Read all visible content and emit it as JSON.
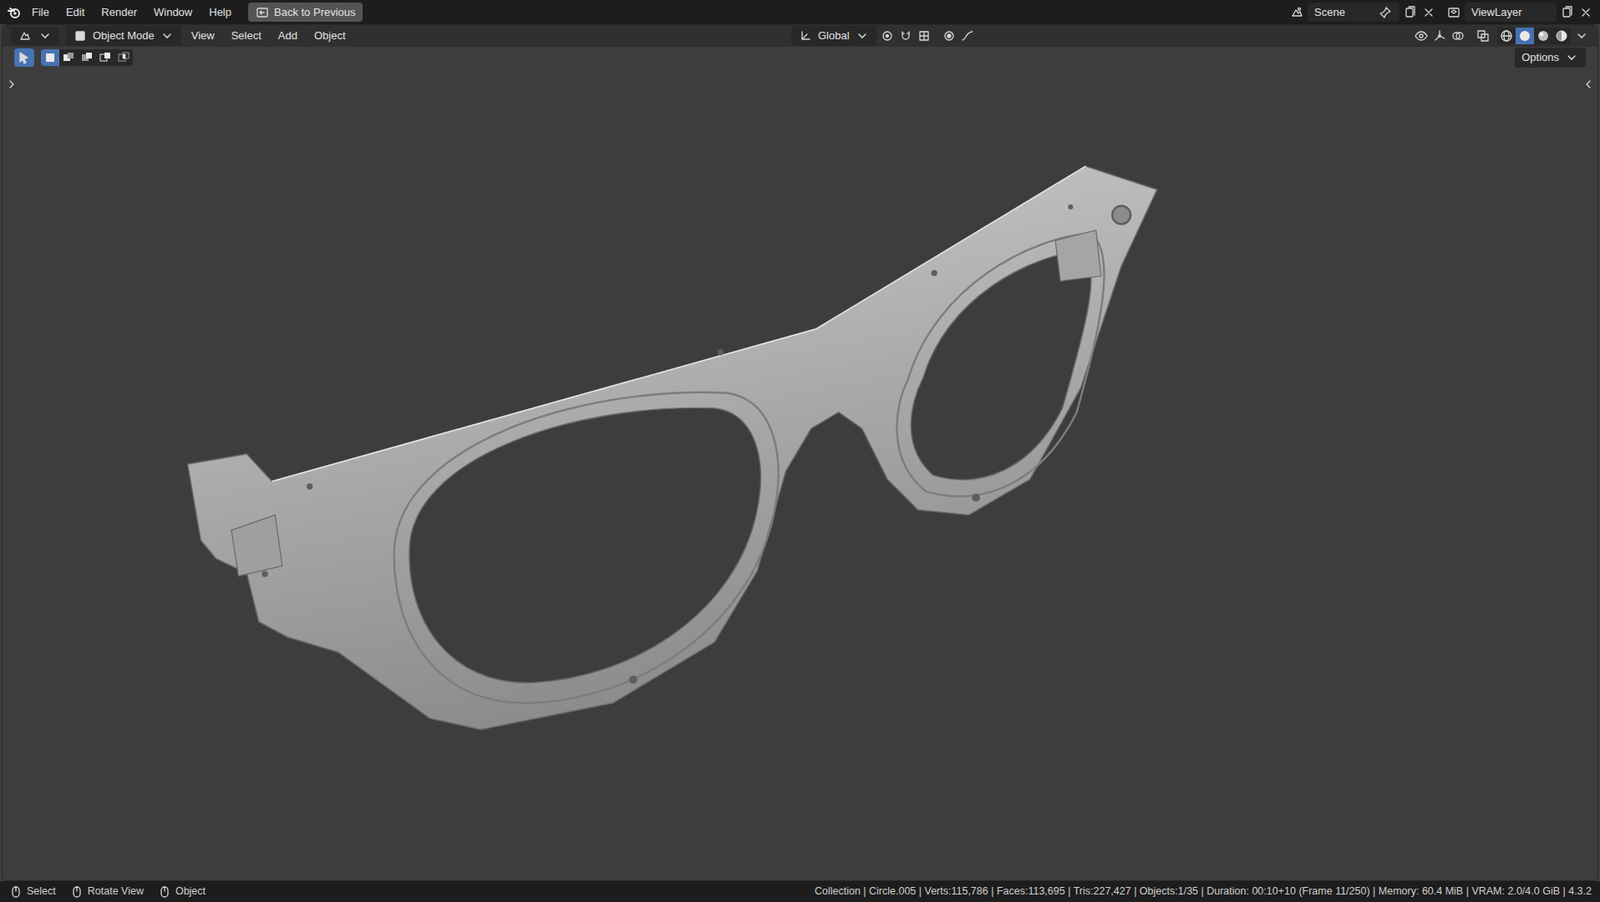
{
  "menu_bar": {
    "items": [
      "File",
      "Edit",
      "Render",
      "Window",
      "Help"
    ],
    "back_button": "Back to Previous",
    "scene": "Scene",
    "view_layer": "ViewLayer"
  },
  "header": {
    "mode": "Object Mode",
    "menus": [
      "View",
      "Select",
      "Add",
      "Object"
    ],
    "orientation": "Global",
    "shading": [
      {
        "kind": "wireframe",
        "selected": false
      },
      {
        "kind": "solid",
        "selected": true
      },
      {
        "kind": "material",
        "selected": false
      },
      {
        "kind": "rendered",
        "selected": false
      }
    ]
  },
  "toolbar": {
    "select_tool": {
      "selected": true
    },
    "select_modes": [
      {
        "kind": "set",
        "selected": true
      },
      {
        "kind": "extend",
        "selected": false
      },
      {
        "kind": "subtract",
        "selected": false
      },
      {
        "kind": "invert",
        "selected": false
      },
      {
        "kind": "intersect",
        "selected": false
      }
    ],
    "options": "Options"
  },
  "status_bar": {
    "hints": [
      "Select",
      "Rotate View",
      "Object"
    ],
    "stats": "Collection | Circle.005 | Verts:115,786 | Faces:113,695 | Tris:227,427 | Objects:1/35 | Duration: 00:10+10 (Frame 11/250) | Memory: 60.4 MiB | VRAM: 2.0/4.0 GiB | 4.3.2"
  }
}
